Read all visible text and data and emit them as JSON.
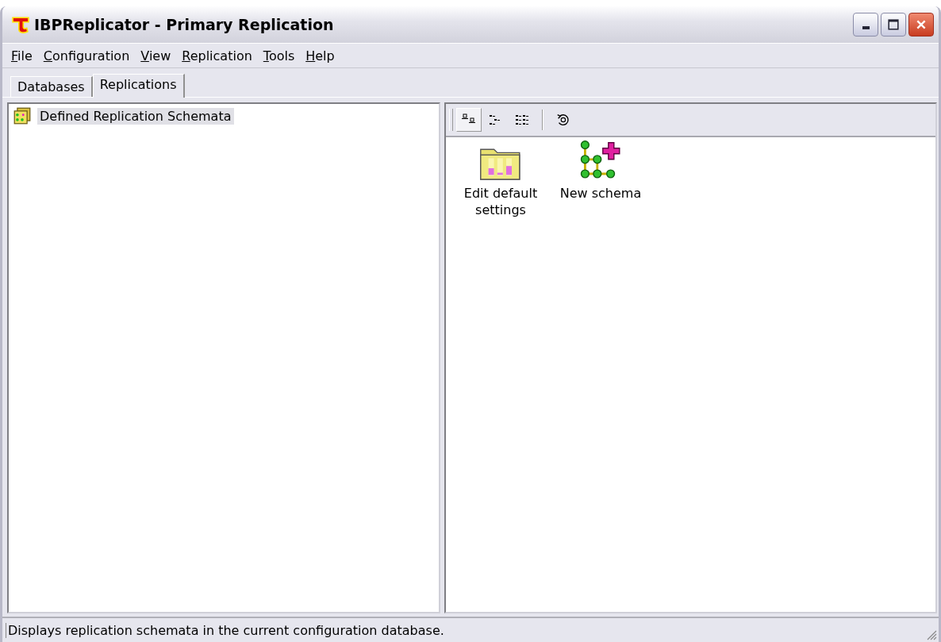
{
  "window": {
    "title": "IBPReplicator - Primary Replication"
  },
  "menu": [
    "File",
    "Configuration",
    "View",
    "Replication",
    "Tools",
    "Help"
  ],
  "tabs": [
    {
      "label": "Databases",
      "selected": false
    },
    {
      "label": "Replications",
      "selected": true
    }
  ],
  "tree": {
    "items": [
      {
        "label": "Defined Replication Schemata",
        "selected": true
      }
    ]
  },
  "toolbar": {
    "view_buttons": [
      {
        "kind": "large-icons",
        "selected": true
      },
      {
        "kind": "small-icons",
        "selected": false
      },
      {
        "kind": "list",
        "selected": false
      }
    ]
  },
  "items": [
    {
      "kind": "folder",
      "label": "Edit default settings"
    },
    {
      "kind": "schema",
      "label": "New schema"
    }
  ],
  "status_bar": "Displays replication schemata in the current configuration database."
}
